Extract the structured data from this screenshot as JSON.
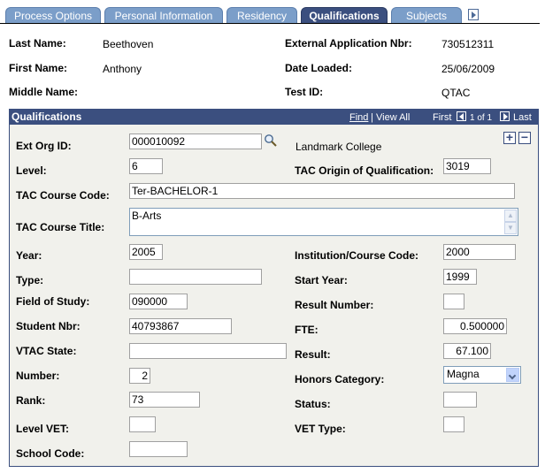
{
  "tabs": [
    {
      "label": "Process Options",
      "active": false
    },
    {
      "label": "Personal Information",
      "active": false
    },
    {
      "label": "Residency",
      "active": false
    },
    {
      "label": "Qualifications",
      "active": true
    },
    {
      "label": "Subjects",
      "active": false
    }
  ],
  "tabs_more_icon": "right-arrow-icon",
  "header": {
    "last_name_label": "Last Name:",
    "last_name": "Beethoven",
    "first_name_label": "First Name:",
    "first_name": "Anthony",
    "middle_name_label": "Middle Name:",
    "middle_name": "",
    "ext_app_nbr_label": "External Application Nbr:",
    "ext_app_nbr": "730512311",
    "date_loaded_label": "Date Loaded:",
    "date_loaded": "25/06/2009",
    "test_id_label": "Test ID:",
    "test_id": "QTAC"
  },
  "group": {
    "title": "Qualifications",
    "find": "Find",
    "separator": "|",
    "view_all": "View All",
    "first": "First",
    "page": "1 of 1",
    "last": "Last",
    "add_icon": "+",
    "delete_icon": "−"
  },
  "fields": {
    "ext_org_id": {
      "label": "Ext Org ID:",
      "value": "000010092",
      "description": "Landmark College"
    },
    "level": {
      "label": "Level:",
      "value": "6"
    },
    "tac_origin": {
      "label": "TAC Origin of Qualification:",
      "value": "3019"
    },
    "tac_course_code": {
      "label": "TAC Course Code:",
      "value": "Ter-BACHELOR-1"
    },
    "tac_course_title": {
      "label": "TAC Course Title:",
      "value": "B-Arts"
    },
    "year": {
      "label": "Year:",
      "value": "2005"
    },
    "institution_course_code": {
      "label": "Institution/Course Code:",
      "value": "2000"
    },
    "type": {
      "label": "Type:",
      "value": ""
    },
    "start_year": {
      "label": "Start Year:",
      "value": "1999"
    },
    "field_of_study": {
      "label": "Field of Study:",
      "value": "090000"
    },
    "result_number": {
      "label": "Result Number:",
      "value": ""
    },
    "student_nbr": {
      "label": "Student Nbr:",
      "value": "40793867"
    },
    "fte": {
      "label": "FTE:",
      "value": "0.500000"
    },
    "vtac_state": {
      "label": "VTAC State:",
      "value": ""
    },
    "result": {
      "label": "Result:",
      "value": "67.100"
    },
    "number": {
      "label": "Number:",
      "value": "2"
    },
    "honors_category": {
      "label": "Honors Category:",
      "value": "Magna"
    },
    "rank": {
      "label": "Rank:",
      "value": "73"
    },
    "status": {
      "label": "Status:",
      "value": ""
    },
    "level_vet": {
      "label": "Level VET:",
      "value": ""
    },
    "vet_type": {
      "label": "VET Type:",
      "value": ""
    },
    "school_code": {
      "label": "School Code:",
      "value": ""
    }
  }
}
